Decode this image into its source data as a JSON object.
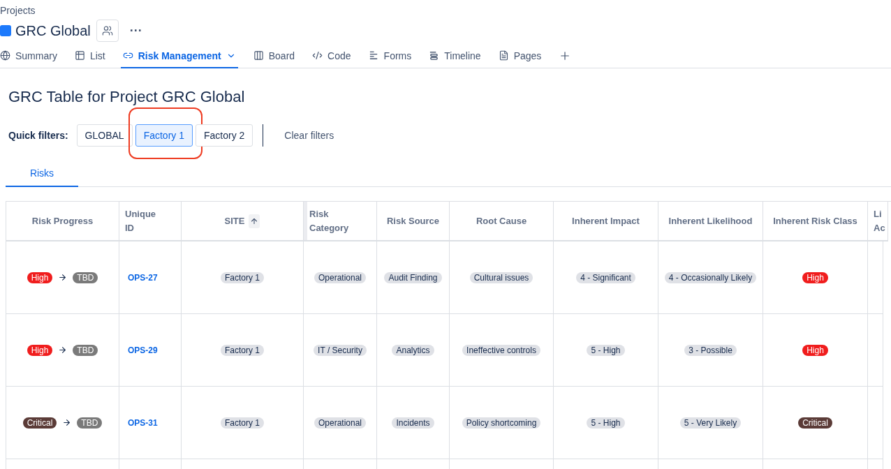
{
  "breadcrumb": "Projects",
  "project": {
    "name": "GRC Global",
    "more": "···"
  },
  "nav_tabs": [
    {
      "label": "Summary",
      "selected": false
    },
    {
      "label": "List",
      "selected": false
    },
    {
      "label": "Risk Management",
      "selected": true
    },
    {
      "label": "Board",
      "selected": false
    },
    {
      "label": "Code",
      "selected": false
    },
    {
      "label": "Forms",
      "selected": false
    },
    {
      "label": "Timeline",
      "selected": false
    },
    {
      "label": "Pages",
      "selected": false
    }
  ],
  "page_title": "GRC Table for Project GRC Global",
  "quick_filters": {
    "label": "Quick filters:",
    "items": [
      {
        "label": "GLOBAL",
        "selected": false,
        "highlighted": false
      },
      {
        "label": "Factory 1",
        "selected": true,
        "highlighted": true
      },
      {
        "label": "Factory 2",
        "selected": false,
        "highlighted": false
      }
    ],
    "clear": "Clear filters"
  },
  "view_tabs": [
    {
      "label": "Risks",
      "selected": true
    }
  ],
  "table": {
    "columns": [
      "Risk Progress",
      "Unique ID",
      "SITE",
      "Risk Category",
      "Risk Source",
      "Root Cause",
      "Inherent Impact",
      "Inherent Likelihood",
      "Inherent Risk Class",
      "Li Ac"
    ],
    "rows": [
      {
        "progress_from": {
          "text": "High",
          "color": "#f01d1d"
        },
        "progress_to": {
          "text": "TBD",
          "color": "#7a7a7a"
        },
        "id": "OPS-27",
        "site": "Factory 1",
        "category": "Operational",
        "source": "Audit Finding",
        "root_cause": "Cultural issues",
        "impact": "4 - Significant",
        "likelihood": "4 - Occasionally Likely",
        "risk_class": {
          "text": "High",
          "color": "#f01d1d"
        }
      },
      {
        "progress_from": {
          "text": "High",
          "color": "#f01d1d"
        },
        "progress_to": {
          "text": "TBD",
          "color": "#7a7a7a"
        },
        "id": "OPS-29",
        "site": "Factory 1",
        "category": "IT / Security",
        "source": "Analytics",
        "root_cause": "Ineffective controls",
        "impact": "5 - High",
        "likelihood": "3 - Possible",
        "risk_class": {
          "text": "High",
          "color": "#f01d1d"
        }
      },
      {
        "progress_from": {
          "text": "Critical",
          "color": "#5b3b37"
        },
        "progress_to": {
          "text": "TBD",
          "color": "#7a7a7a"
        },
        "id": "OPS-31",
        "site": "Factory 1",
        "category": "Operational",
        "source": "Incidents",
        "root_cause": "Policy shortcoming",
        "impact": "5 - High",
        "likelihood": "5 - Very Likely",
        "risk_class": {
          "text": "Critical",
          "color": "#5b3b37"
        }
      }
    ]
  }
}
